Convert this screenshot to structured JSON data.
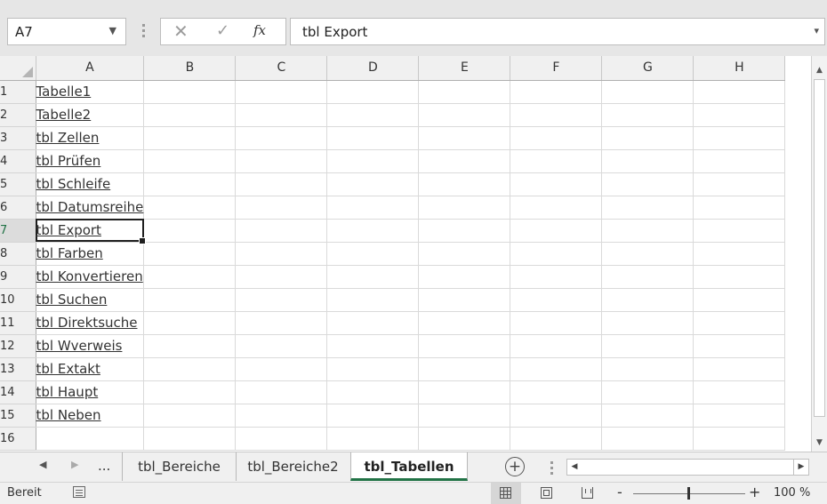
{
  "formula_bar": {
    "name_box": "A7",
    "name_box_dropdown_icon": "chevron-down-icon",
    "cancel_icon": "✕",
    "enter_icon": "✓",
    "function_icon": "fx",
    "formula": "tbl Export",
    "expand_icon": "chevron-down-icon"
  },
  "grid": {
    "columns": [
      "A",
      "B",
      "C",
      "D",
      "E",
      "F",
      "G",
      "H"
    ],
    "active_cell": "A7",
    "rows": [
      {
        "num": "1",
        "a": "Tabelle1"
      },
      {
        "num": "2",
        "a": "Tabelle2"
      },
      {
        "num": "3",
        "a": "tbl Zellen"
      },
      {
        "num": "4",
        "a": "tbl Prüfen"
      },
      {
        "num": "5",
        "a": "tbl Schleife"
      },
      {
        "num": "6",
        "a": "tbl Datumsreihe"
      },
      {
        "num": "7",
        "a": "tbl Export"
      },
      {
        "num": "8",
        "a": "tbl Farben"
      },
      {
        "num": "9",
        "a": "tbl Konvertieren"
      },
      {
        "num": "10",
        "a": "tbl Suchen"
      },
      {
        "num": "11",
        "a": "tbl Direktsuche"
      },
      {
        "num": "12",
        "a": "tbl Wverweis"
      },
      {
        "num": "13",
        "a": "tbl Extakt"
      },
      {
        "num": "14",
        "a": "tbl Haupt"
      },
      {
        "num": "15",
        "a": "tbl Neben"
      },
      {
        "num": "16",
        "a": ""
      }
    ]
  },
  "sheet_tabs": {
    "more": "...",
    "tabs": [
      "tbl_Bereiche",
      "tbl_Bereiche2",
      "tbl_Tabellen"
    ],
    "active": "tbl_Tabellen",
    "add_icon": "+"
  },
  "status_bar": {
    "ready": "Bereit",
    "zoom_minus": "-",
    "zoom_plus": "+",
    "zoom": "100 %",
    "view": "normal"
  },
  "colors": {
    "accent": "#217346",
    "header_bg": "#f0f0f0",
    "gridline": "#dadada"
  }
}
